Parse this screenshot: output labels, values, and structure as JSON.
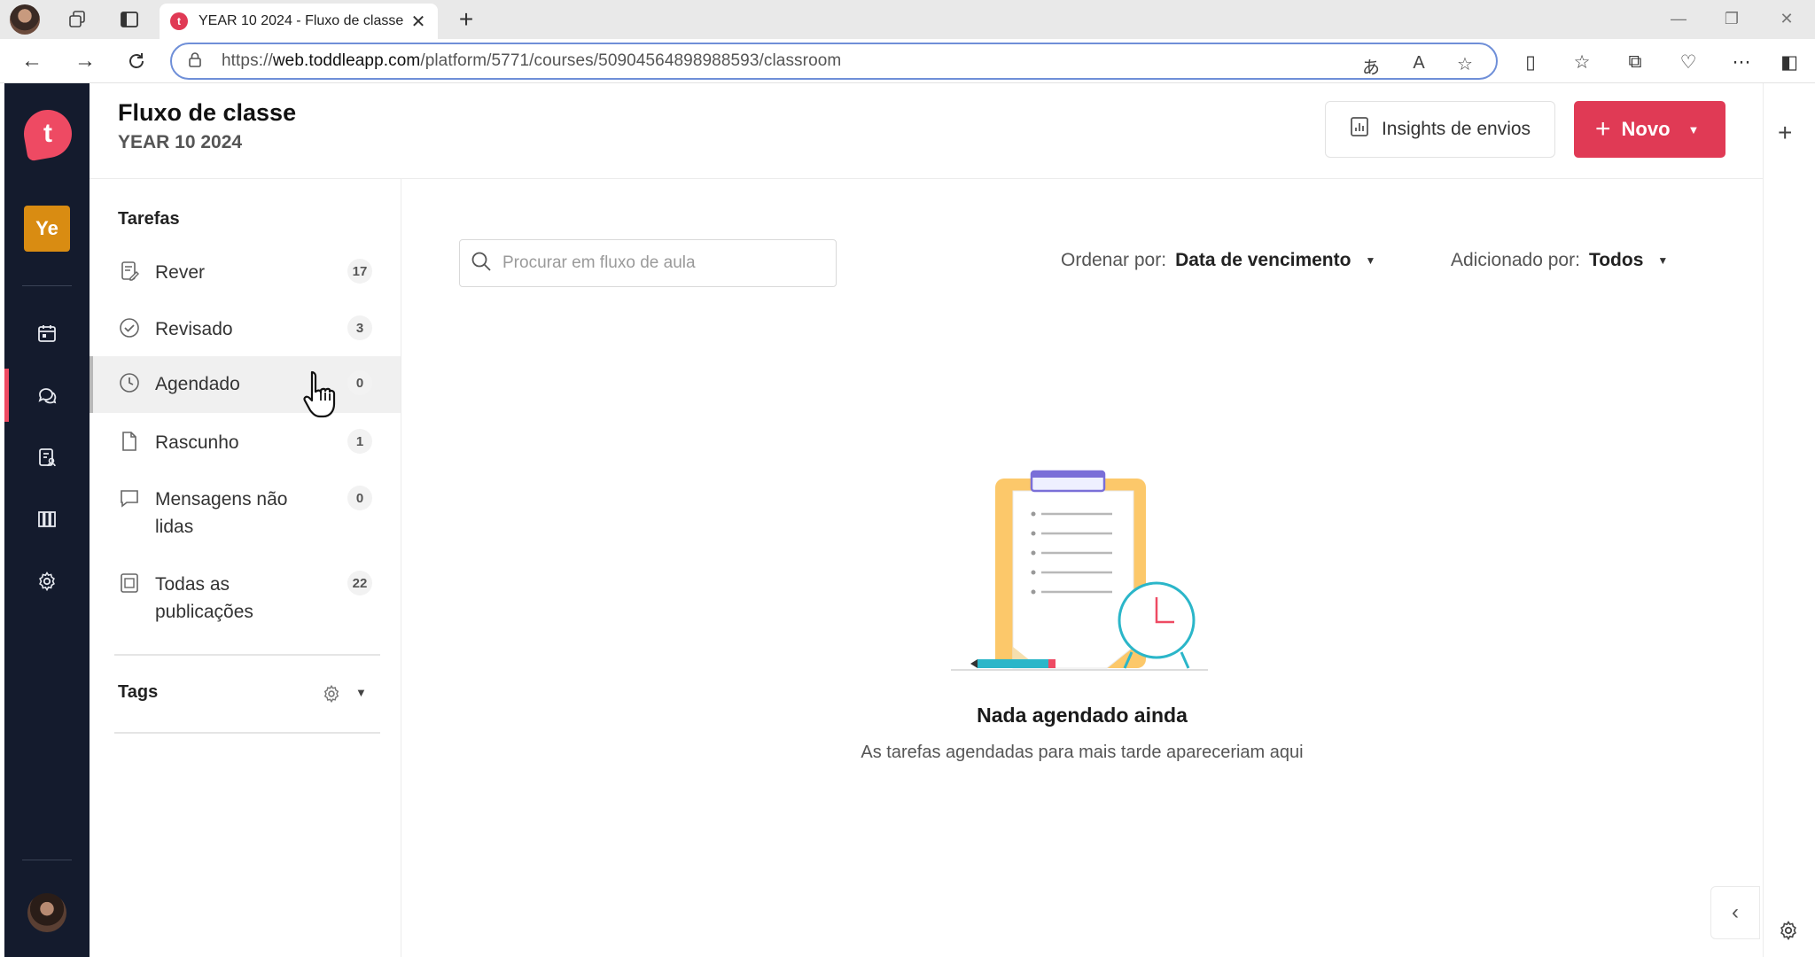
{
  "browser": {
    "tab_title": "YEAR 10 2024 - Fluxo de classe",
    "tab_favicon": "t",
    "url_prefix": "https://",
    "url_host": "web.toddleapp.com",
    "url_path": "/platform/5771/courses/50904564898988593/classroom",
    "window_controls": [
      "minimize",
      "restore",
      "close"
    ]
  },
  "rail": {
    "logo": "t",
    "course_badge": "Ye",
    "items": [
      {
        "icon": "calendar-icon"
      },
      {
        "icon": "chat-icon",
        "active": true
      },
      {
        "icon": "student-portfolio-icon"
      },
      {
        "icon": "library-icon"
      },
      {
        "icon": "gear-icon"
      }
    ]
  },
  "header": {
    "title": "Fluxo de classe",
    "subtitle": "YEAR 10 2024",
    "insights_label": "Insights de envios",
    "new_label": "Novo"
  },
  "filters": {
    "title": "Tarefas",
    "items": [
      {
        "label": "Rever",
        "count": "17",
        "icon": "review-icon"
      },
      {
        "label": "Revisado",
        "count": "3",
        "icon": "check-circle-icon"
      },
      {
        "label": "Agendado",
        "count": "0",
        "icon": "clock-icon",
        "active": true
      },
      {
        "label": "Rascunho",
        "count": "1",
        "icon": "draft-icon"
      },
      {
        "label": "Mensagens não lidas",
        "count": "0",
        "icon": "message-icon"
      },
      {
        "label": "Todas as publicações",
        "count": "22",
        "icon": "all-posts-icon"
      }
    ],
    "tags_title": "Tags"
  },
  "main": {
    "search_placeholder": "Procurar em fluxo de aula",
    "sort_label": "Ordenar por:",
    "sort_value": "Data de vencimento",
    "added_label": "Adicionado por:",
    "added_value": "Todos",
    "empty_title": "Nada agendado ainda",
    "empty_subtitle": "As tarefas agendadas para mais tarde apareceriam aqui"
  },
  "colors": {
    "brand": "#e03a55",
    "rail_bg": "#141b2d",
    "badge": "#d98c12"
  }
}
